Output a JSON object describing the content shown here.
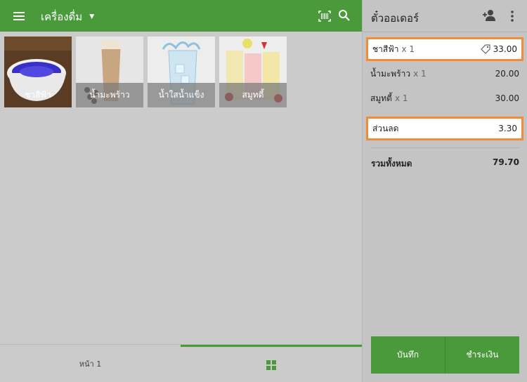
{
  "topbar": {
    "category": "เครื่องดื่ม"
  },
  "products": [
    {
      "name": "ชาสีฟ้า"
    },
    {
      "name": "น้ำมะพร้าว"
    },
    {
      "name": "น้ำใสน้ำแข็ง"
    },
    {
      "name": "สมูทตี้"
    }
  ],
  "bottom": {
    "page_label": "หน้า 1"
  },
  "ticket": {
    "title": "ตั๋วออเดอร์",
    "items": [
      {
        "name": "ชาสีฟ้า",
        "qty": "x 1",
        "amount": "33.00",
        "icon": "tag-icon"
      },
      {
        "name": "น้ำมะพร้าว",
        "qty": "x 1",
        "amount": "20.00"
      },
      {
        "name": "สมูทตี้",
        "qty": "x 1",
        "amount": "30.00"
      }
    ],
    "discount": {
      "label": "ส่วนลด",
      "amount": "3.30"
    },
    "total": {
      "label": "รวมทั้งหมด",
      "amount": "79.70"
    },
    "save_label": "บันทึก",
    "charge_label": "ชำระเงิน"
  },
  "colors": {
    "accent": "#4a9a3c",
    "highlight": "#f08c3a"
  }
}
